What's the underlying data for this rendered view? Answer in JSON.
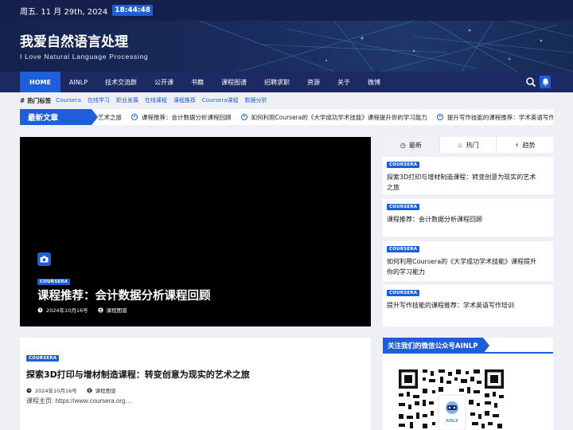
{
  "topbar": {
    "date": "周五. 11 月 29th, 2024",
    "time": "18:44:48"
  },
  "site": {
    "title": "我爱自然语言处理",
    "tagline": "I Love Natural Language Processing"
  },
  "nav": {
    "items": [
      "HOME",
      "AINLP",
      "技术交流群",
      "公开课",
      "书籍",
      "课程图谱",
      "招聘求职",
      "资源",
      "关于",
      "微博"
    ],
    "active_index": 0
  },
  "tags": {
    "label": "热门标签",
    "items": [
      "Coursera",
      "在线学习",
      "职业发展",
      "在线课程",
      "课程推荐",
      "Coursera课程",
      "数据分析"
    ]
  },
  "ticker": {
    "label": "最新文章",
    "items": [
      "艺术之旅",
      "课程推荐：会计数据分析课程回顾",
      "如何利用Coursera的《大学成功学术技能》课程提升你的学习能力",
      "提升写作技能的课程推荐：学术英语写作培训",
      ""
    ]
  },
  "featured": {
    "category": "COURSERA",
    "title": "课程推荐：会计数据分析课程回顾",
    "date": "2024年10月16号",
    "author": "课程图谱"
  },
  "card": {
    "category": "COURSERA",
    "title": "探索3D打印与增材制造课程：转变创意为现实的艺术之旅",
    "date": "2024年10月16号",
    "author": "课程图谱",
    "excerpt": "课程主页: https://www.coursera.org…"
  },
  "sidebar": {
    "tabs": [
      {
        "label": "最新",
        "icon": "clock-icon"
      },
      {
        "label": "热门",
        "icon": "fire-icon"
      },
      {
        "label": "趋势",
        "icon": "bolt-icon"
      }
    ],
    "items": [
      {
        "category": "COURSERA",
        "title": "探索3D打印与增材制造课程：转变创意为现实的艺术之旅"
      },
      {
        "category": "COURSERA",
        "title": "课程推荐：会计数据分析课程回顾"
      },
      {
        "category": "COURSERA",
        "title": "如何利用Coursera的《大学成功学术技能》课程提升你的学习能力"
      },
      {
        "category": "COURSERA",
        "title": "提升写作技能的课程推荐：学术英语写作培训"
      }
    ]
  },
  "wechat": {
    "title": "关注我们的微信公众号AINLP",
    "logo_text": "AINLP"
  },
  "colors": {
    "accent": "#1e5ed9",
    "nav": "#1b2a63",
    "topbar": "#15204d"
  }
}
